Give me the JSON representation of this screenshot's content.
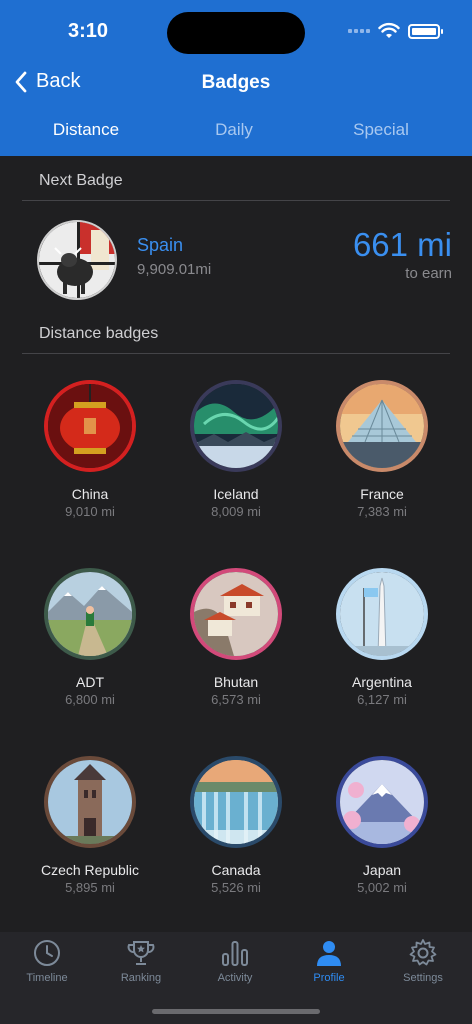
{
  "status": {
    "time": "3:10"
  },
  "nav": {
    "back_label": "Back",
    "title": "Badges"
  },
  "tabs": [
    {
      "label": "Distance",
      "active": true
    },
    {
      "label": "Daily",
      "active": false
    },
    {
      "label": "Special",
      "active": false
    }
  ],
  "next": {
    "section_title": "Next Badge",
    "name": "Spain",
    "distance": "9,909.01mi",
    "earn_value": "661 mi",
    "earn_label": "to earn"
  },
  "distance_section_title": "Distance badges",
  "badges": [
    {
      "name": "China",
      "distance": "9,010 mi",
      "ring": "#d42020"
    },
    {
      "name": "Iceland",
      "distance": "8,009 mi",
      "ring": "#3a3a5a"
    },
    {
      "name": "France",
      "distance": "7,383 mi",
      "ring": "#c98a6a"
    },
    {
      "name": "ADT",
      "distance": "6,800 mi",
      "ring": "#3d5a4a"
    },
    {
      "name": "Bhutan",
      "distance": "6,573 mi",
      "ring": "#d24a7a"
    },
    {
      "name": "Argentina",
      "distance": "6,127 mi",
      "ring": "#b8d8f0"
    },
    {
      "name": "Czech Republic",
      "distance": "5,895 mi",
      "ring": "#6a4a3a"
    },
    {
      "name": "Canada",
      "distance": "5,526 mi",
      "ring": "#2a4a6a"
    },
    {
      "name": "Japan",
      "distance": "5,002 mi",
      "ring": "#3a4a9a"
    }
  ],
  "tabbar": [
    {
      "label": "Timeline",
      "icon": "clock-icon",
      "active": false
    },
    {
      "label": "Ranking",
      "icon": "trophy-icon",
      "active": false
    },
    {
      "label": "Activity",
      "icon": "bar-chart-icon",
      "active": false
    },
    {
      "label": "Profile",
      "icon": "person-icon",
      "active": true
    },
    {
      "label": "Settings",
      "icon": "gear-icon",
      "active": false
    }
  ],
  "colors": {
    "header": "#1f6fd1",
    "accent": "#3a8ff0",
    "background": "#1f1f21"
  }
}
